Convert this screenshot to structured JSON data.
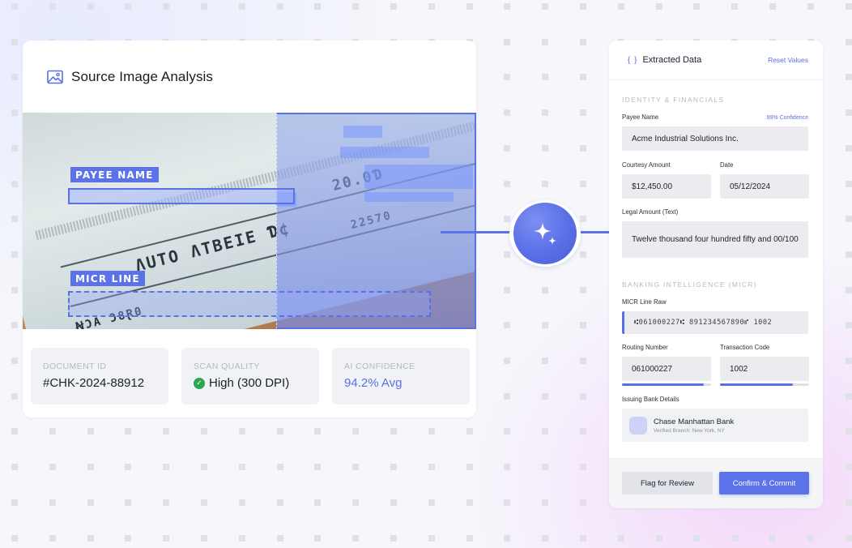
{
  "source_panel": {
    "title": "Source Image Analysis",
    "tags": {
      "payee": "PAYEE NAME",
      "micr": "MICR LINE"
    },
    "stats": [
      {
        "label": "DOCUMENT ID",
        "value": "#CHK-2024-88912"
      },
      {
        "label": "SCAN QUALITY",
        "value": "High (300 DPI)"
      },
      {
        "label": "AI CONFIDENCE",
        "value": "94.2% Avg"
      }
    ]
  },
  "extracted": {
    "title": "Extracted Data",
    "reset_label": "Reset Values",
    "identity_section": "IDENTITY & FINANCIALS",
    "payee_label": "Payee Name",
    "payee_confidence": "99% Confidence",
    "payee_value": "Acme Industrial Solutions Inc.",
    "courtesy_label": "Courtesy Amount",
    "courtesy_value": "$12,450.00",
    "date_label": "Date",
    "date_value": "05/12/2024",
    "legal_label": "Legal Amount (Text)",
    "legal_value": "Twelve thousand four hundred fifty and 00/100",
    "banking_section": "BANKING INTELLIGENCE (MICR)",
    "micr_label": "MICR Line Raw",
    "micr_value": "⑆061000227⑆ 891234567890⑈ 1002",
    "routing_label": "Routing Number",
    "routing_value": "061000227",
    "routing_progress": 0.92,
    "transaction_label": "Transaction Code",
    "transaction_value": "1002",
    "transaction_progress": 0.82,
    "bank_label": "Issuing Bank Details",
    "bank_name": "Chase Manhattan Bank",
    "bank_branch": "Verified Branch: New York, NY",
    "flag_button": "Flag for Review",
    "confirm_button": "Confirm & Commit"
  },
  "colors": {
    "accent": "#5b72e8",
    "success": "#2aa84f"
  }
}
